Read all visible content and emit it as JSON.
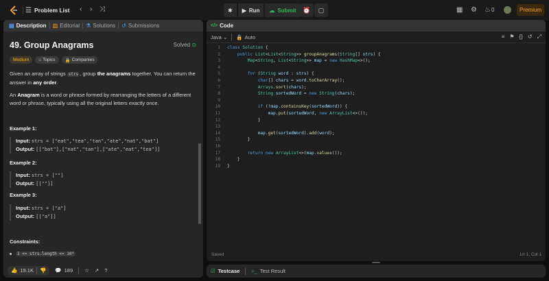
{
  "nav": {
    "problem_list": "Problem List",
    "run": "Run",
    "submit": "Submit",
    "streak": "0",
    "premium": "Premium"
  },
  "tabs": [
    {
      "label": "Description"
    },
    {
      "label": "Editorial"
    },
    {
      "label": "Solutions"
    },
    {
      "label": "Submissions"
    }
  ],
  "problem": {
    "title": "49. Group Anagrams",
    "status": "Solved",
    "difficulty": "Medium",
    "topics": "Topics",
    "companies": "Companies",
    "p1_a": "Given an array of strings ",
    "p1_code": "strs",
    "p1_b": ", group ",
    "p1_bold": "the anagrams",
    "p1_c": " together. You can return the answer in ",
    "p1_bold2": "any order",
    "p1_d": ".",
    "p2_bold": "Anagram",
    "p2_a": "An ",
    "p2_b": " is a word or phrase formed by rearranging the letters of a different word or phrase, typically using all the original letters exactly once.",
    "examples": [
      {
        "title": "Example 1:",
        "input": "strs = [\"eat\",\"tea\",\"tan\",\"ate\",\"nat\",\"bat\"]",
        "output": "[[\"bat\"],[\"nat\",\"tan\"],[\"ate\",\"eat\",\"tea\"]]"
      },
      {
        "title": "Example 2:",
        "input": "strs = [\"\"]",
        "output": "[[\"\"]]"
      },
      {
        "title": "Example 3:",
        "input": "strs = [\"a\"]",
        "output": "[[\"a\"]]"
      }
    ],
    "input_label": "Input:",
    "output_label": "Output:",
    "constraints_title": "Constraints:",
    "constraint1": "1 <= strs.length <= 10⁴"
  },
  "footer": {
    "likes": "19.1K",
    "comments": "189"
  },
  "editor": {
    "header": "Code",
    "language": "Java",
    "mode": "Auto",
    "status": "Saved",
    "position": "Ln 1, Col 1"
  },
  "code_lines": [
    "class Solution {",
    "    public List<List<String>> groupAnagrams(String[] strs) {",
    "        Map<String, List<String>> map = new HashMap<>();",
    "",
    "        for (String word : strs) {",
    "            char[] chars = word.toCharArray();",
    "            Arrays.sort(chars);",
    "            String sortedWord = new String(chars);",
    "",
    "            if (!map.containsKey(sortedWord)) {",
    "                map.put(sortedWord, new ArrayList<>());",
    "            }",
    "",
    "            map.get(sortedWord).add(word);",
    "        }",
    "",
    "        return new ArrayList<>(map.values());",
    "    }",
    "}"
  ],
  "test": {
    "testcase": "Testcase",
    "result": "Test Result"
  },
  "colors": {
    "accent_green": "#2cbb5d",
    "premium": "#ffa116",
    "medium": "#ffb800"
  }
}
